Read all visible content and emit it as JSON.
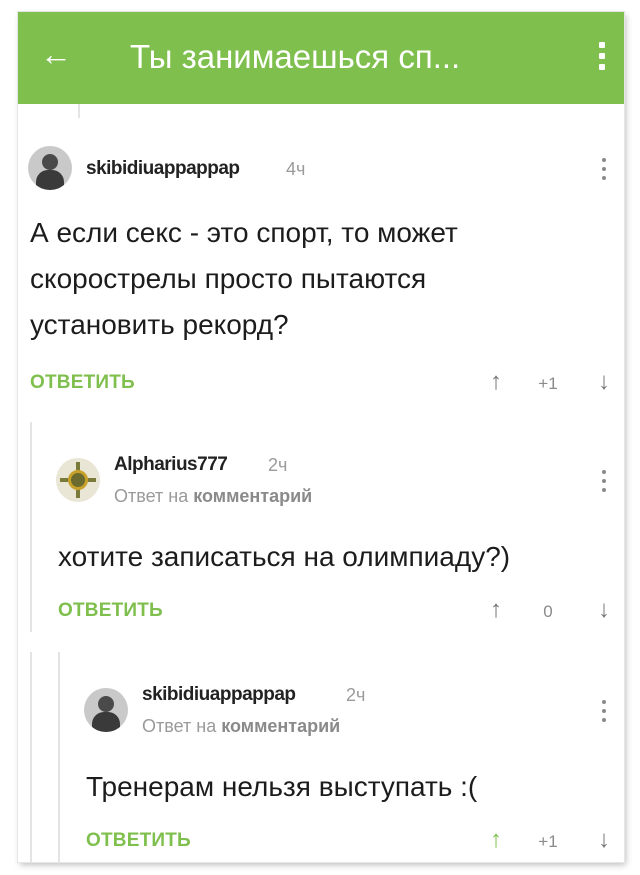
{
  "appbar": {
    "title": "Ты занимаешься сп...",
    "back_icon": "arrow-left-icon",
    "menu_icon": "kebab-menu-icon",
    "color": "#7fbf4d"
  },
  "comments": [
    {
      "username": "skibidiuappappap",
      "time": "4ч",
      "text_lines": [
        "А если секс - это спорт, то может",
        "скорострелы просто пытаются",
        "установить рекорд?"
      ],
      "reply_label": "ОТВЕТИТЬ",
      "score": "+1"
    },
    {
      "username": "Alpharius777",
      "time": "2ч",
      "reply_prefix": "Ответ на",
      "reply_target": "комментарий",
      "text_lines": [
        "хотите записаться на олимпиаду?)"
      ],
      "reply_label": "ОТВЕТИТЬ",
      "score": "0"
    },
    {
      "username": "skibidiuappappap",
      "time": "2ч",
      "reply_prefix": "Ответ на",
      "reply_target": "комментарий",
      "text_lines": [
        "Тренерам нельзя выступать :("
      ],
      "reply_label": "ОТВЕТИТЬ",
      "score": "+1",
      "upvoted": true
    }
  ],
  "icons": {
    "upvote": "↑",
    "downvote": "↓",
    "back": "←"
  },
  "colors": {
    "accent": "#7fbf4d",
    "upvoted": "#7fbf4d"
  }
}
